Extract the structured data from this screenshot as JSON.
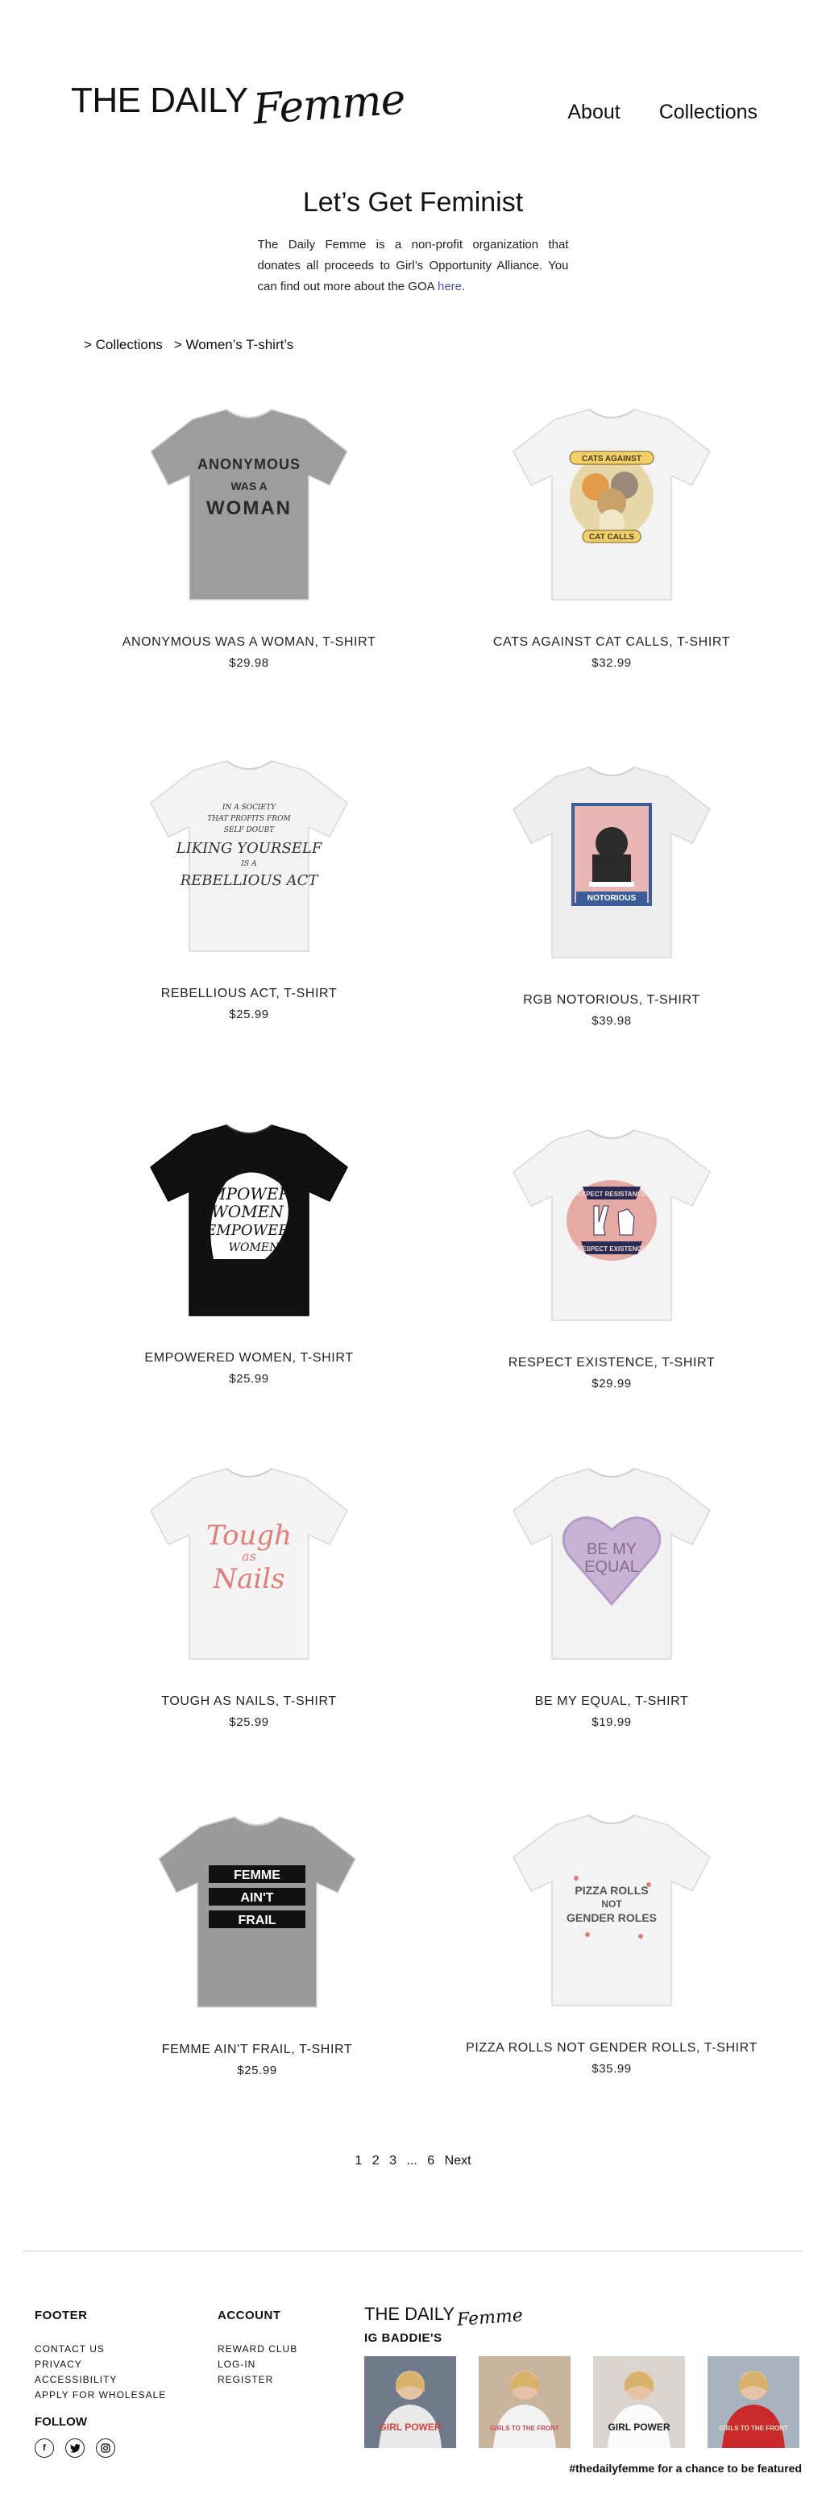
{
  "header": {
    "logo_main": "THE DAILY",
    "logo_script": "Femme",
    "nav": [
      "About",
      "Collections"
    ]
  },
  "intro": {
    "title": "Let’s Get Feminist",
    "body": "The Daily Femme is a non-profit organization that donates all proceeds to Girl’s Opportunity Alliance. You can find out more about the GOA ",
    "link": "here",
    "after_link": "."
  },
  "breadcrumb": [
    "> Collections",
    "> Women’s T-shirt’s"
  ],
  "products": [
    {
      "title": "ANONYMOUS WAS A WOMAN, T-SHIRT",
      "price": "$29.98",
      "shirt_color": "#9d9d9d",
      "design": "anonymous",
      "print": [
        "ANONYMOUS",
        "WAS A",
        "WOMAN"
      ]
    },
    {
      "title": "CATS AGAINST CAT CALLS, T-SHIRT",
      "price": "$32.99",
      "shirt_color": "#f3f3f3",
      "design": "cats",
      "print": [
        "CATS AGAINST",
        "CAT CALLS"
      ]
    },
    {
      "title": "REBELLIOUS ACT, T-SHIRT",
      "price": "$25.99",
      "shirt_color": "#f3f3f3",
      "design": "rebellious",
      "print": [
        "IN A SOCIETY",
        "THAT PROFITS FROM",
        "SELF DOUBT",
        "LIKING YOURSELF",
        "IS A",
        "REBELLIOUS ACT"
      ]
    },
    {
      "title": "RGB NOTORIOUS, T-SHIRT",
      "price": "$39.98",
      "shirt_color": "#eeeeee",
      "design": "rgb",
      "print": [
        "NOTORIOUS"
      ]
    },
    {
      "title": "EMPOWERED WOMEN, T-SHIRT",
      "price": "$25.99",
      "shirt_color": "#111111",
      "design": "empowered",
      "print": [
        "EMPOWERED",
        "WOMEN",
        "EMPOWER",
        "WOMEN"
      ]
    },
    {
      "title": "RESPECT EXISTENCE, T-SHIRT",
      "price": "$29.99",
      "shirt_color": "#f3f3f3",
      "design": "respect",
      "print": [
        "EXPECT RESISTANCE",
        "RESPECT EXISTENCE"
      ]
    },
    {
      "title": "TOUGH AS NAILS, T-SHIRT",
      "price": "$25.99",
      "shirt_color": "#f4f4f4",
      "design": "tough",
      "print": [
        "Tough",
        "as",
        "Nails"
      ]
    },
    {
      "title": "BE MY EQUAL, T-SHIRT",
      "price": "$19.99",
      "shirt_color": "#f2f2f2",
      "design": "equal",
      "print": [
        "BE MY",
        "EQUAL"
      ]
    },
    {
      "title": "FEMME AIN'T FRAIL, T-SHIRT",
      "price": "$25.99",
      "shirt_color": "#9b9b9b",
      "design": "frail",
      "print": [
        "FEMME",
        "AIN'T",
        "FRAIL"
      ]
    },
    {
      "title": "PIZZA ROLLS NOT GENDER ROLLS, T-SHIRT",
      "price": "$35.99",
      "shirt_color": "#f3f3f3",
      "design": "pizza",
      "print": [
        "PIZZA ROLLS",
        "NOT",
        "GENDER ROLES"
      ]
    }
  ],
  "pagination": [
    "1",
    "2",
    "3",
    "...",
    "6",
    "Next"
  ],
  "footer": {
    "footer_heading": "FOOTER",
    "footer_links": [
      "CONTACT US",
      "PRIVACY",
      "ACCESSIBILITY",
      "APPLY FOR WHOLESALE"
    ],
    "account_heading": "ACCOUNT",
    "account_links": [
      "REWARD CLUB",
      "LOG-IN",
      "REGISTER"
    ],
    "follow_heading": "FOLLOW",
    "social": [
      "facebook-icon",
      "twitter-icon",
      "instagram-icon"
    ],
    "ig_logo_main": "THE DAILY",
    "ig_logo_script": "Femme",
    "ig_heading": "IG BADDIE'S",
    "ig_caption": "#thedailyfemme for a chance to be featured",
    "ig_photos": [
      {
        "caption": "GIRL POWER",
        "bg": "#6f7a8a",
        "shirt": "#e9e9e9",
        "accent": "#d2463c"
      },
      {
        "caption": "GIRLS TO THE FRONT",
        "bg": "#c9b59d",
        "shirt": "#f2f2f2",
        "accent": "#c64a5a"
      },
      {
        "caption": "GIRL POWER",
        "bg": "#d9d4cf",
        "shirt": "#fafafa",
        "accent": "#222222"
      },
      {
        "caption": "GIRLS TO THE FRONT",
        "bg": "#a9b3bd",
        "shirt": "#c9292b",
        "accent": "#f3e3d0"
      }
    ]
  }
}
